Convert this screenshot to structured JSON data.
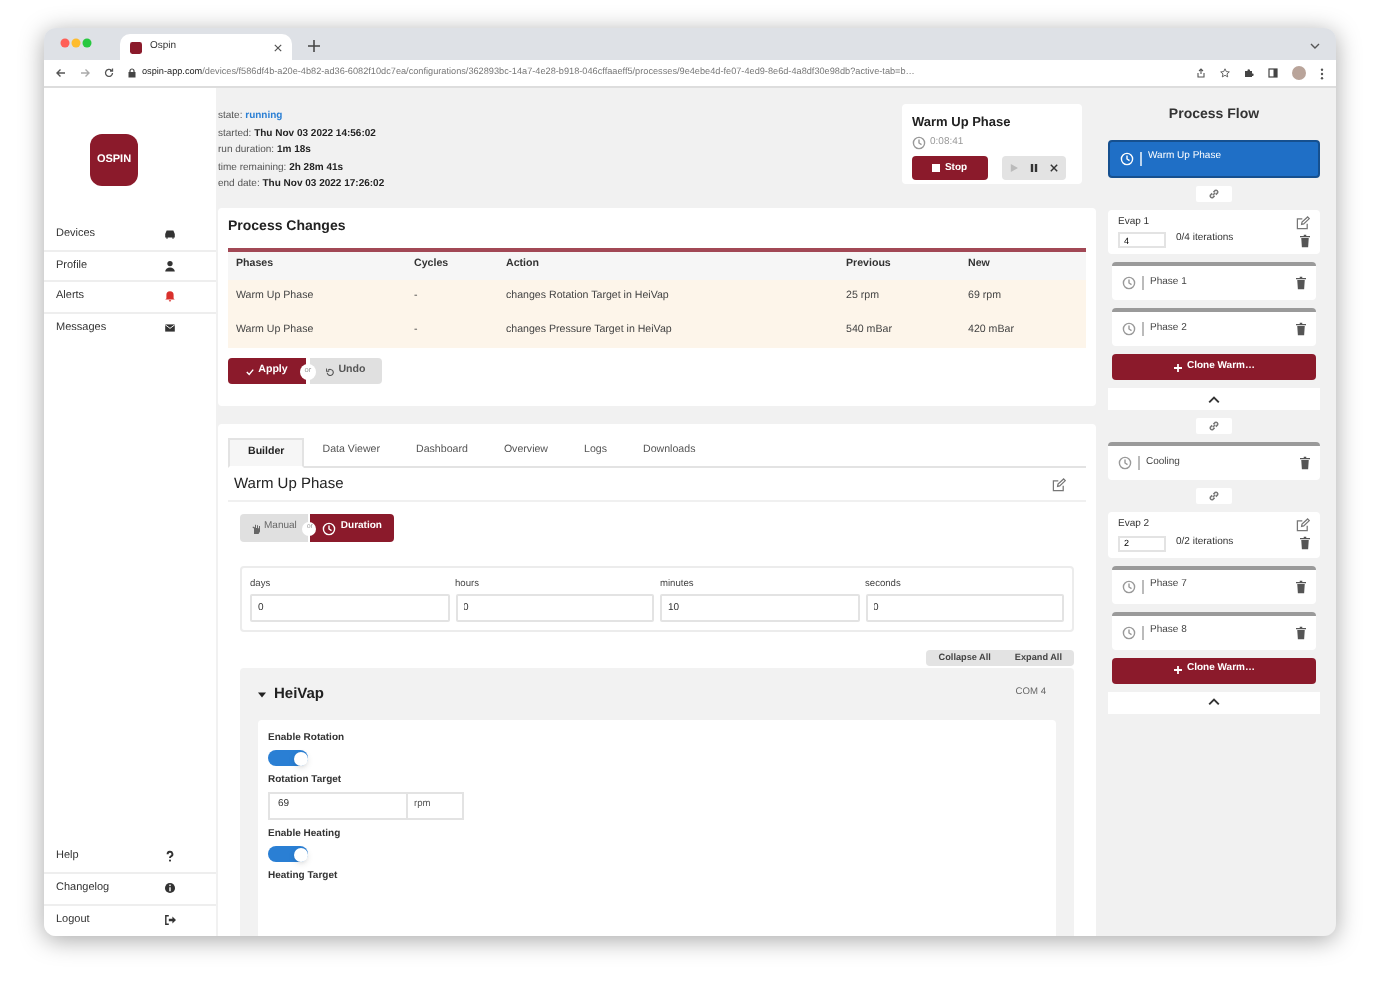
{
  "browser": {
    "tab_title": "Ospin",
    "url_host": "ospin-app.com",
    "url_path": "/devices/f586df4b-a20e-4b82-ad36-6082f10dc7ea/configurations/362893bc-14a7-4e28-b918-046cffaaeff5/processes/9e4ebe4d-fe07-4ed9-8e6d-4a8df30e98db?active-tab=b…"
  },
  "sidebar": {
    "logo": "OSPIN",
    "items": [
      {
        "label": "Devices"
      },
      {
        "label": "Profile"
      },
      {
        "label": "Alerts"
      },
      {
        "label": "Messages"
      }
    ],
    "footer_items": [
      {
        "label": "Help"
      },
      {
        "label": "Changelog"
      },
      {
        "label": "Logout"
      }
    ]
  },
  "process_info": [
    {
      "label": "state:",
      "value": "running",
      "kind": "status"
    },
    {
      "label": "started:",
      "value": "Thu Nov 03 2022 14:56:02",
      "kind": "plain"
    },
    {
      "label": "run duration:",
      "value": "1m 18s",
      "kind": "plain"
    },
    {
      "label": "time remaining:",
      "value": "2h 28m 41s",
      "kind": "plain"
    },
    {
      "label": "end date:",
      "value": "Thu Nov 03 2022 17:26:02",
      "kind": "plain"
    }
  ],
  "phase_card": {
    "title": "Warm Up Phase",
    "timer": "0:08:41",
    "stop_button": "Stop"
  },
  "process_changes": {
    "title": "Process Changes",
    "columns": [
      "Phases",
      "Cycles",
      "Action",
      "Previous",
      "New"
    ],
    "rows": [
      [
        "Warm Up Phase",
        "-",
        "changes Rotation Target in HeiVap",
        "25 rpm",
        "69 rpm"
      ],
      [
        "Warm Up Phase",
        "-",
        "changes Pressure Target in HeiVap",
        "540 mBar",
        "420 mBar"
      ]
    ],
    "apply_button": "Apply",
    "separator": "or",
    "undo_button": "Undo"
  },
  "builder": {
    "tabs": [
      {
        "label": "Builder",
        "selected": true
      },
      {
        "label": "Data Viewer",
        "selected": false
      },
      {
        "label": "Dashboard",
        "selected": false
      },
      {
        "label": "Overview",
        "selected": false
      },
      {
        "label": "Logs",
        "selected": false
      },
      {
        "label": "Downloads",
        "selected": false
      }
    ],
    "phase_title": "Warm Up Phase",
    "modes": [
      {
        "label": "Manual",
        "selected": false
      },
      {
        "label": "Duration",
        "selected": true
      }
    ],
    "mode_separator": "or",
    "duration_fields": [
      {
        "label": "days",
        "value": "0"
      },
      {
        "label": "hours",
        "value": "0"
      },
      {
        "label": "minutes",
        "value": "10"
      },
      {
        "label": "seconds",
        "value": "0"
      }
    ],
    "collapse_all": "Collapse All",
    "expand_all": "Expand All",
    "device": {
      "name": "HeiVap",
      "port": "COM 4",
      "expanded": true,
      "settings": [
        {
          "kind": "toggle",
          "label": "Enable Rotation",
          "on": true
        },
        {
          "kind": "number",
          "label": "Rotation Target",
          "value": "69",
          "unit": "rpm"
        },
        {
          "kind": "toggle",
          "label": "Enable Heating",
          "on": true
        },
        {
          "kind": "heading",
          "label": "Heating Target"
        }
      ]
    }
  },
  "process_flow": {
    "title": "Process Flow",
    "items": [
      {
        "kind": "phase",
        "name": "Warm Up Phase",
        "selected": true
      },
      {
        "kind": "link"
      },
      {
        "kind": "loop",
        "name": "Evap 1",
        "iterations": "4",
        "progress": "0/4 iterations",
        "children": [
          {
            "name": "Phase 1",
            "selected": false
          },
          {
            "name": "Phase 2",
            "selected": false
          }
        ],
        "clone_button": "Clone Warm…"
      },
      {
        "kind": "link"
      },
      {
        "kind": "phase",
        "name": "Cooling",
        "selected": false
      },
      {
        "kind": "link"
      },
      {
        "kind": "loop",
        "name": "Evap 2",
        "iterations": "2",
        "progress": "0/2 iterations",
        "children": [
          {
            "name": "Phase 7",
            "selected": false
          },
          {
            "name": "Phase 8",
            "selected": false
          }
        ],
        "clone_button": "Clone Warm…"
      }
    ]
  }
}
